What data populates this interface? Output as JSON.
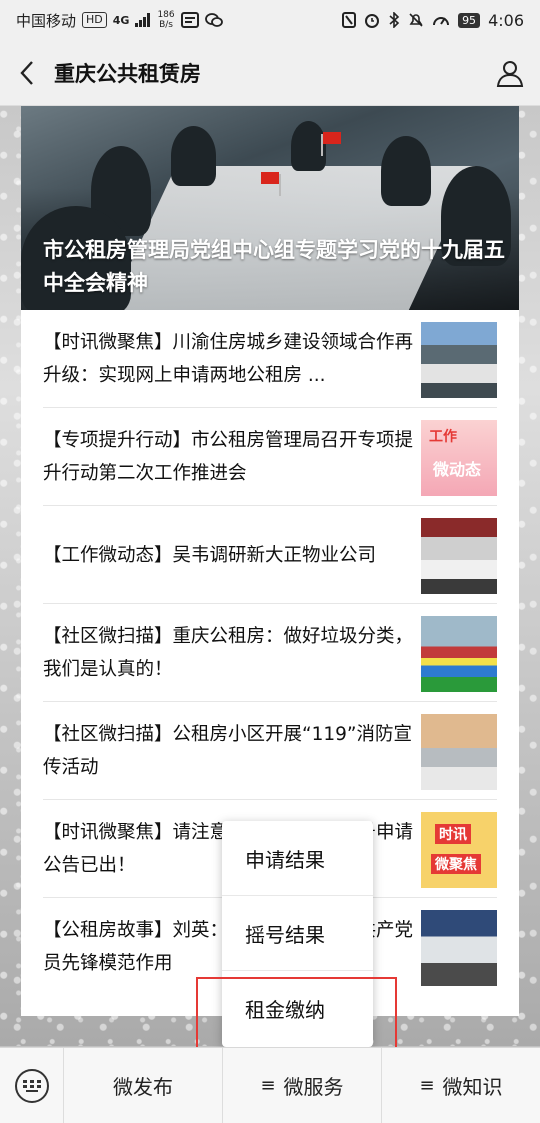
{
  "status": {
    "carrier": "中国移动",
    "hd": "HD",
    "net": "4G",
    "speed_top": "186",
    "speed_bottom": "B/s",
    "battery": "95",
    "time": "4:06"
  },
  "nav": {
    "title": "重庆公共租赁房"
  },
  "hero": {
    "title": "市公租房管理局党组中心组专题学习党的十九届五中全会精神"
  },
  "articles": [
    {
      "text": "【时讯微聚焦】川渝住房城乡建设领域合作再升级：实现网上申请两地公租房 ..."
    },
    {
      "text": "【专项提升行动】市公租房管理局召开专项提升行动第二次工作推进会",
      "thumb_top": "工作",
      "thumb_bottom": "微动态"
    },
    {
      "text": "【工作微动态】吴韦调研新大正物业公司"
    },
    {
      "text": "【社区微扫描】重庆公租房：做好垃圾分类，我们是认真的！"
    },
    {
      "text": "【社区微扫描】公租房小区开展“119”消防宣传活动"
    },
    {
      "text": "【时讯微聚焦】请注意！重庆公租房摇号申请公告已出！",
      "thumb_top": "时讯",
      "thumb_bottom": "微聚焦"
    },
    {
      "text": "【公租房故事】刘英：立足公租房发挥共产党员先锋模范作用"
    }
  ],
  "popup": {
    "items": [
      "申请结果",
      "摇号结果",
      "租金缴纳"
    ]
  },
  "tabbar": {
    "tab1": "微发布",
    "tab2": "微服务",
    "tab3": "微知识",
    "menu_glyph": "≡"
  },
  "colors": {
    "highlight": "#e53935",
    "flag": "#d9251c"
  }
}
